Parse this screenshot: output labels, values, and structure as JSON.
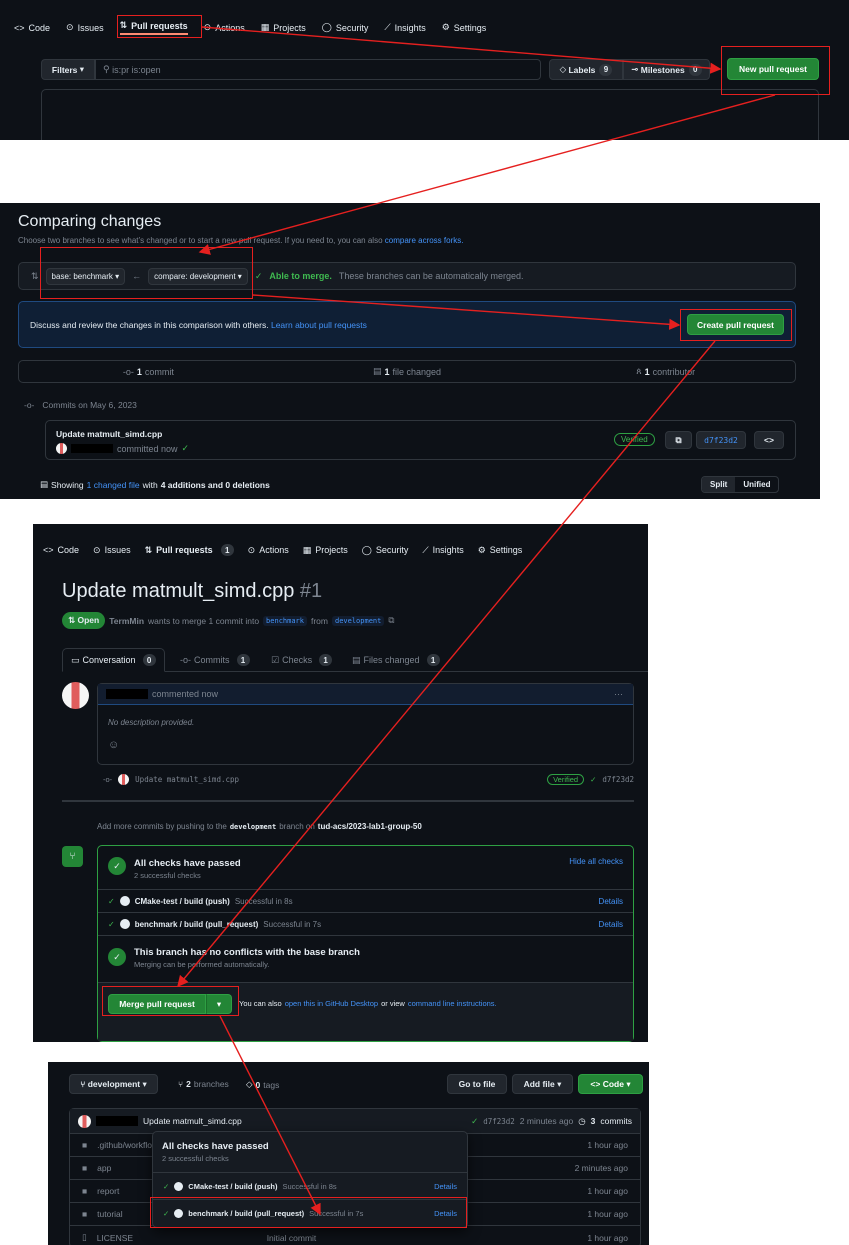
{
  "panel1": {
    "nav": {
      "code": "Code",
      "issues": "Issues",
      "pull_requests": "Pull requests",
      "actions": "Actions",
      "projects": "Projects",
      "security": "Security",
      "insights": "Insights",
      "settings": "Settings"
    },
    "filters_label": "Filters",
    "search_value": "is:pr is:open",
    "labels_label": "Labels",
    "labels_count": "9",
    "milestones_label": "Milestones",
    "milestones_count": "0",
    "new_pr_label": "New pull request"
  },
  "panel2": {
    "title": "Comparing changes",
    "subtitle": "Choose two branches to see what’s changed or to start a new pull request. If you need to, you can also",
    "subtitle_link": "compare across forks.",
    "base_branch": "base: benchmark",
    "compare_branch": "compare: development",
    "able_to_merge": "Able to merge.",
    "merge_note": "These branches can be automatically merged.",
    "discuss_text": "Discuss and review the changes in this comparison with others.",
    "discuss_link": "Learn about pull requests",
    "create_pr_label": "Create pull request",
    "stats": {
      "commits_n": "1",
      "commits_label": "commit",
      "files_n": "1",
      "files_label": "file changed",
      "contrib_n": "1",
      "contrib_label": "contributor"
    },
    "commits_date": "Commits on May 6, 2023",
    "commit_message": "Update matmult_simd.cpp",
    "committed_text": "committed now",
    "verified": "Verified",
    "sha": "d7f23d2",
    "showing_prefix": "Showing",
    "showing_link": "1 changed file",
    "showing_with": "with",
    "showing_stats": "4 additions and 0 deletions",
    "split_label": "Split",
    "unified_label": "Unified"
  },
  "panel3": {
    "nav": {
      "code": "Code",
      "issues": "Issues",
      "pull_requests": "Pull requests",
      "pr_count": "1",
      "actions": "Actions",
      "projects": "Projects",
      "security": "Security",
      "insights": "Insights",
      "settings": "Settings"
    },
    "pr_title": "Update matmult_simd.cpp",
    "pr_number": "#1",
    "state": "Open",
    "author": "TermMin",
    "wants_text": "wants to merge 1 commit into",
    "base": "benchmark",
    "from_text": "from",
    "head": "development",
    "tabs": {
      "conversation": "Conversation",
      "conversation_n": "0",
      "commits": "Commits",
      "commits_n": "1",
      "checks": "Checks",
      "checks_n": "1",
      "files": "Files changed",
      "files_n": "1"
    },
    "commented": "commented now",
    "no_description": "No description provided.",
    "timeline_commit": "Update matmult_simd.cpp",
    "verified": "Verified",
    "sha": "d7f23d2",
    "push_note_prefix": "Add more commits by pushing to the",
    "push_branch": "development",
    "push_note_mid": "branch on",
    "push_repo": "tud-acs/2023-lab1-group-50",
    "checks_title": "All checks have passed",
    "checks_sub": "2 successful checks",
    "hide_checks": "Hide all checks",
    "check1_name": "CMake-test / build (push)",
    "check1_status": "Successful in 8s",
    "check2_name": "benchmark / build (pull_request)",
    "check2_status": "Successful in 7s",
    "details": "Details",
    "no_conflicts_title": "This branch has no conflicts with the base branch",
    "no_conflicts_sub": "Merging can be performed automatically.",
    "merge_label": "Merge pull request",
    "merge_note_prefix": "You can also",
    "merge_note_link1": "open this in GitHub Desktop",
    "merge_note_mid": "or view",
    "merge_note_link2": "command line instructions."
  },
  "panel4": {
    "branch": "development",
    "branches_n": "2",
    "branches_label": "branches",
    "tags_n": "0",
    "tags_label": "tags",
    "goto_file": "Go to file",
    "add_file": "Add file",
    "code": "Code",
    "commit_message": "Update matmult_simd.cpp",
    "sha": "d7f23d2",
    "commit_time": "2 minutes ago",
    "commits_n": "3",
    "commits_label": "commits",
    "files": [
      {
        "name": ".github/workflows",
        "time": "1 hour ago"
      },
      {
        "name": "app",
        "time": "2 minutes ago"
      },
      {
        "name": "report",
        "time": "1 hour ago"
      },
      {
        "name": "tutorial",
        "time": "1 hour ago"
      },
      {
        "name": "LICENSE",
        "msg": "Initial commit",
        "time": "1 hour ago"
      }
    ],
    "popup": {
      "title": "All checks have passed",
      "sub": "2 successful checks",
      "check1_name": "CMake-test / build (push)",
      "check1_status": "Successful in 8s",
      "check2_name": "benchmark / build (pull_request)",
      "check2_status": "Successful in 7s",
      "details": "Details"
    }
  },
  "colors": {
    "bg": "#0d1117",
    "border": "#30363d",
    "green": "#238636",
    "link": "#4493f8",
    "annotation": "#e5201f"
  }
}
